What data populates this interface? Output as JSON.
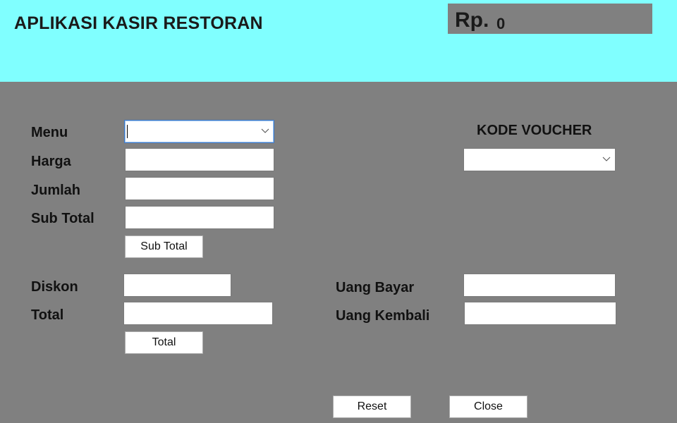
{
  "header": {
    "title": "APLIKASI KASIR RESTORAN",
    "total_prefix": "Rp.",
    "total_value": "0",
    "background_color": "#80FFFF"
  },
  "form": {
    "background_color": "#808080",
    "menu": {
      "label": "Menu",
      "value": ""
    },
    "harga": {
      "label": "Harga",
      "value": ""
    },
    "jumlah": {
      "label": "Jumlah",
      "value": ""
    },
    "sub_total": {
      "label": "Sub Total",
      "value": ""
    },
    "sub_total_button": "Sub Total",
    "diskon": {
      "label": "Diskon",
      "value": ""
    },
    "total": {
      "label": "Total",
      "value": ""
    },
    "total_button": "Total",
    "voucher": {
      "label": "KODE VOUCHER",
      "value": ""
    },
    "uang_bayar": {
      "label": "Uang Bayar",
      "value": ""
    },
    "uang_kembali": {
      "label": "Uang Kembali",
      "value": ""
    }
  },
  "actions": {
    "reset": "Reset",
    "close": "Close"
  },
  "icons": {
    "dropdown": "chevron-down-icon"
  }
}
